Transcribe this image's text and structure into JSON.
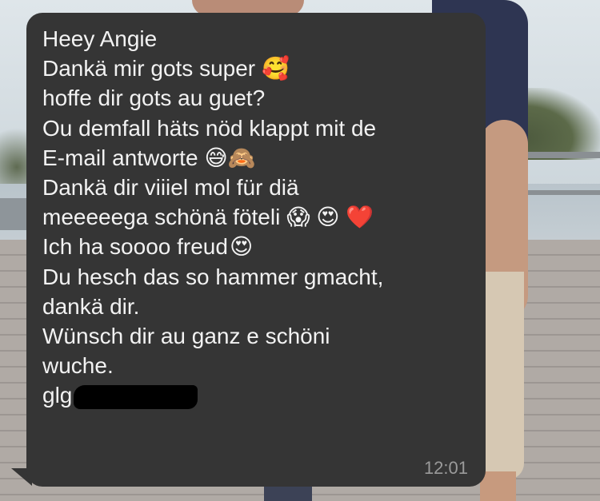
{
  "message": {
    "lines": [
      {
        "text": "Heey Angie",
        "emoji": ""
      },
      {
        "text": "Dankä mir gots super",
        "emoji": "🥰"
      },
      {
        "text": "hoffe dir gots au guet?",
        "emoji": ""
      },
      {
        "text": "Ou demfall häts nöd klappt mit de",
        "emoji": ""
      },
      {
        "text": "E-mail antworte",
        "emoji": "😅🙈"
      },
      {
        "text": "Dankä dir viiiel mol für diä",
        "emoji": ""
      },
      {
        "text": "meeeeega schönä föteli",
        "emoji": "😱 😍 ❤️"
      },
      {
        "text": "Ich ha soooo freud",
        "emoji": "😍"
      },
      {
        "text": "Du hesch das so hammer gmacht,",
        "emoji": ""
      },
      {
        "text": "dankä dir.",
        "emoji": ""
      },
      {
        "text": "Wünsch dir au ganz e schöni",
        "emoji": ""
      },
      {
        "text": "wuche.",
        "emoji": ""
      },
      {
        "text": "glg",
        "emoji": ""
      }
    ],
    "timestamp": "12:01"
  }
}
